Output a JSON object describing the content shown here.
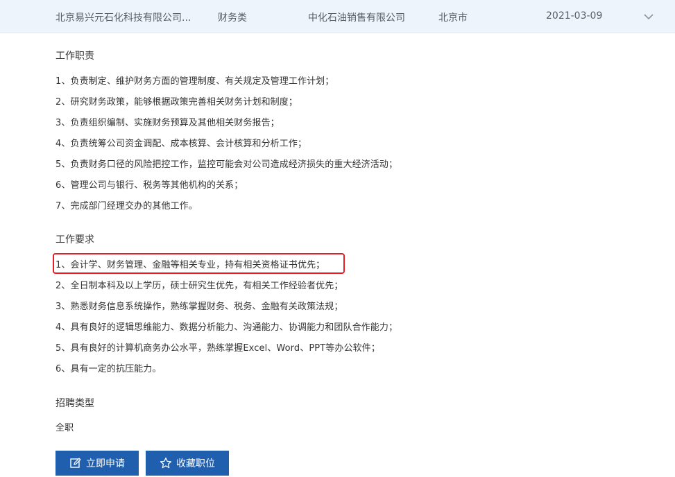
{
  "job_row": {
    "company": "北京易兴元石化科技有限公司...",
    "category": "财务类",
    "unit": "中化石油销售有限公司",
    "city": "北京市",
    "date": "2021-03-09",
    "expand_icon": "chevron-down-icon"
  },
  "duties": {
    "title": "工作职责",
    "items": [
      "1、负责制定、维护财务方面的管理制度、有关规定及管理工作计划；",
      "2、研究财务政策，能够根据政策完善相关财务计划和制度；",
      "3、负责组织编制、实施财务预算及其他相关财务报告；",
      "4、负责统筹公司资金调配、成本核算、会计核算和分析工作；",
      "5、负责财务口径的风险把控工作，监控可能会对公司造成经济损失的重大经济活动；",
      "6、管理公司与银行、税务等其他机构的关系；",
      "7、完成部门经理交办的其他工作。"
    ]
  },
  "requirements": {
    "title": "工作要求",
    "items": [
      "1、会计学、财务管理、金融等相关专业，持有相关资格证书优先；",
      "2、全日制本科及以上学历，硕士研究生优先，有相关工作经验者优先；",
      "3、熟悉财务信息系统操作，熟练掌握财务、税务、金融有关政策法规；",
      "4、具有良好的逻辑思维能力、数据分析能力、沟通能力、协调能力和团队合作能力；",
      "5、具有良好的计算机商务办公水平，熟练掌握Excel、Word、PPT等办公软件；",
      "6、具有一定的抗压能力。"
    ],
    "highlight_color": "#e51c23"
  },
  "recruit_type": {
    "title": "招聘类型",
    "value": "全职"
  },
  "actions": {
    "apply_label": "立即申请",
    "apply_icon": "edit-icon",
    "favorite_label": "收藏职位",
    "favorite_icon": "star-icon"
  },
  "colors": {
    "header_bg": "#edf4fc",
    "button_bg": "#1f5fae"
  }
}
